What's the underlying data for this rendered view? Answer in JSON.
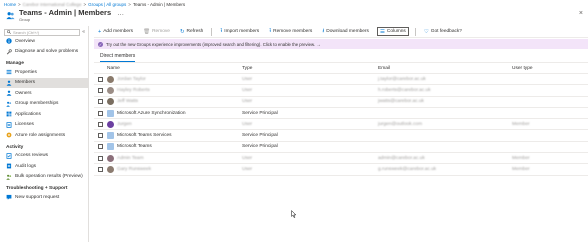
{
  "breadcrumb": {
    "items": [
      "Home",
      "Carebor International College",
      "Groups | All groups",
      "Teams - Admin | Members"
    ]
  },
  "header": {
    "title": "Teams - Admin | Members",
    "subtitle": "Group",
    "more": "…",
    "close": "×"
  },
  "sidebar": {
    "search_placeholder": "Search (Ctrl+/)",
    "collapse": "«",
    "top_items": [
      {
        "label": "Overview",
        "icon": "info-icon"
      },
      {
        "label": "Diagnose and solve problems",
        "icon": "wrench-icon"
      }
    ],
    "sections": [
      {
        "title": "Manage",
        "items": [
          {
            "label": "Properties",
            "icon": "properties-icon"
          },
          {
            "label": "Members",
            "icon": "members-icon",
            "active": true
          },
          {
            "label": "Owners",
            "icon": "owners-icon"
          },
          {
            "label": "Group memberships",
            "icon": "group-memberships-icon"
          },
          {
            "label": "Applications",
            "icon": "applications-icon"
          },
          {
            "label": "Licenses",
            "icon": "licenses-icon"
          },
          {
            "label": "Azure role assignments",
            "icon": "role-icon"
          }
        ]
      },
      {
        "title": "Activity",
        "items": [
          {
            "label": "Access reviews",
            "icon": "access-reviews-icon"
          },
          {
            "label": "Audit logs",
            "icon": "audit-logs-icon"
          },
          {
            "label": "Bulk operation results (Preview)",
            "icon": "bulk-ops-icon"
          }
        ]
      },
      {
        "title": "Troubleshooting + Support",
        "items": [
          {
            "label": "New support request",
            "icon": "support-icon"
          }
        ]
      }
    ]
  },
  "toolbar": {
    "add_members": "Add members",
    "remove": "Remove",
    "refresh": "Refresh",
    "import_members": "Import members",
    "remove_members": "Remove members",
    "download_members": "Download members",
    "columns": "Columns",
    "got_feedback": "Got feedback?"
  },
  "banner": {
    "text": "Try out the new Groups experience improvements (improved search and filtering). Click to enable the preview. →"
  },
  "tabs": {
    "direct_members": "Direct members"
  },
  "table": {
    "headers": {
      "name": "Name",
      "type": "Type",
      "email": "Email",
      "user_type": "User type"
    },
    "rows": [
      {
        "name": "Jordan Taylor",
        "type": "User",
        "email": "j.taylor@carebor.ac.uk",
        "user_type": "",
        "avatar": "#8a7a6b",
        "sp": false
      },
      {
        "name": "Hayley Roberts",
        "type": "User",
        "email": "h.roberts@carebor.ac.uk",
        "user_type": "",
        "avatar": "#9b8d86",
        "sp": false
      },
      {
        "name": "Jeff Watts",
        "type": "User",
        "email": "jwatts@carebor.ac.uk",
        "user_type": "",
        "avatar": "#7a6e60",
        "sp": false
      },
      {
        "name": "Microsoft Azure Synchronization",
        "type": "Service Principal",
        "email": "",
        "user_type": "",
        "avatar": "#a2c4e8",
        "sp": true
      },
      {
        "name": "Jurgen",
        "type": "User",
        "email": "jurgen@outlook.com",
        "user_type": "Member",
        "avatar": "#6b3fa0",
        "sp": false
      },
      {
        "name": "Microsoft Teams Services",
        "type": "Service Principal",
        "email": "",
        "user_type": "",
        "avatar": "#a2c4e8",
        "sp": true
      },
      {
        "name": "Microsoft Teams",
        "type": "Service Principal",
        "email": "",
        "user_type": "",
        "avatar": "#a2c4e8",
        "sp": true
      },
      {
        "name": "Admin Team",
        "type": "User",
        "email": "admin@carebor.ac.uk",
        "user_type": "Member",
        "avatar": "#8c6f7a",
        "sp": false
      },
      {
        "name": "Gary Runsweek",
        "type": "User",
        "email": "g.runsweek@carebor.ac.uk",
        "user_type": "Member",
        "avatar": "#8c7c70",
        "sp": false
      }
    ]
  }
}
